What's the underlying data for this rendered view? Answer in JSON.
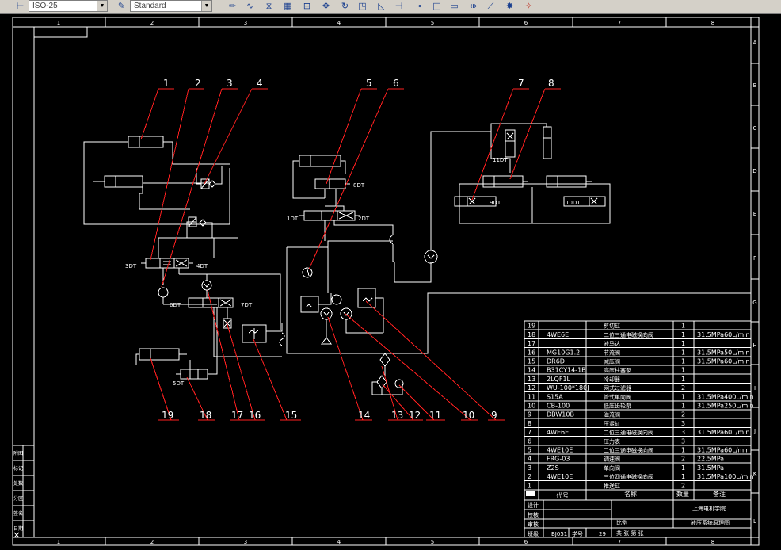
{
  "toolbar": {
    "dimstyle_value": "ISO-25",
    "textstyle_value": "Standard",
    "icons": [
      "dimstyle-icon",
      "textstyle-icon",
      "pencil-icon",
      "fillet-icon",
      "mirror-icon",
      "array-icon",
      "grid-icon",
      "move-icon",
      "rotate-icon",
      "scale-icon",
      "stretch-icon",
      "trim-icon",
      "extend-icon",
      "rectangle-icon",
      "break-icon",
      "chamfer-icon",
      "explode-icon"
    ]
  },
  "frame": {
    "col_numbers": [
      "1",
      "2",
      "3",
      "4",
      "5",
      "6",
      "7",
      "8"
    ],
    "row_letters": [
      "A",
      "B",
      "C",
      "D",
      "E",
      "F",
      "G",
      "H",
      "I",
      "J",
      "K",
      "L"
    ]
  },
  "callouts": {
    "top": [
      "1",
      "2",
      "3",
      "4",
      "5",
      "6",
      "7",
      "8"
    ],
    "bottom": [
      "19",
      "18",
      "17",
      "16",
      "15",
      "14",
      "13",
      "12",
      "11",
      "10",
      "9"
    ]
  },
  "solenoids": {
    "s1": "1DT",
    "s2": "2DT",
    "s3": "3DT",
    "s4": "4DT",
    "s5": "5DT",
    "s6": "6DT",
    "s7": "7DT",
    "s8": "8DT",
    "s9": "9DT",
    "s10": "10DT",
    "s11": "11DT"
  },
  "bom": {
    "rows": [
      {
        "no": "19",
        "code": "",
        "name": "剪切缸",
        "qty": "1",
        "note": ""
      },
      {
        "no": "18",
        "code": "4WE6E",
        "name": "二位三通电磁换向阀",
        "qty": "1",
        "note": "31.5MPa60L/min"
      },
      {
        "no": "17",
        "code": "",
        "name": "液马达",
        "qty": "1",
        "note": ""
      },
      {
        "no": "16",
        "code": "MG10G1.2",
        "name": "节流阀",
        "qty": "1",
        "note": "31.5MPa50L/min"
      },
      {
        "no": "15",
        "code": "DR6D",
        "name": "减压阀",
        "qty": "1",
        "note": "31.5MPa60L/min"
      },
      {
        "no": "14",
        "code": "B31CY14-1B",
        "name": "高压柱塞泵",
        "qty": "1",
        "note": ""
      },
      {
        "no": "13",
        "code": "2LQF1L",
        "name": "冷却器",
        "qty": "1",
        "note": ""
      },
      {
        "no": "12",
        "code": "WU-100*180J",
        "name": "网式过滤器",
        "qty": "2",
        "note": ""
      },
      {
        "no": "11",
        "code": "S15A",
        "name": "管式单向阀",
        "qty": "1",
        "note": "31.5MPa400L/min"
      },
      {
        "no": "10",
        "code": "CB-100",
        "name": "低压齿轮泵",
        "qty": "1",
        "note": "31.5MPa250L/min"
      },
      {
        "no": "9",
        "code": "DBW10B",
        "name": "溢流阀",
        "qty": "2",
        "note": ""
      },
      {
        "no": "8",
        "code": "",
        "name": "压紧缸",
        "qty": "3",
        "note": ""
      },
      {
        "no": "7",
        "code": "4WE6E",
        "name": "二位三通电磁换向阀",
        "qty": "3",
        "note": "31.5MPa60L/min"
      },
      {
        "no": "6",
        "code": "",
        "name": "压力表",
        "qty": "3",
        "note": ""
      },
      {
        "no": "5",
        "code": "4WE10E",
        "name": "二位三通电磁换向阀",
        "qty": "1",
        "note": "31.5MPa60L/min"
      },
      {
        "no": "4",
        "code": "FRG-03",
        "name": "调速阀",
        "qty": "2",
        "note": "22.5MPa"
      },
      {
        "no": "3",
        "code": "Z2S",
        "name": "单向阀",
        "qty": "1",
        "note": "31.5MPa"
      },
      {
        "no": "2",
        "code": "4WE10E",
        "name": "三位四通电磁换向阀",
        "qty": "1",
        "note": "31.5MPa100L/min"
      },
      {
        "no": "1",
        "code": "",
        "name": "推送缸",
        "qty": "2",
        "note": ""
      }
    ],
    "header": {
      "code": "代号",
      "name": "名称",
      "qty": "数量",
      "note": "备注"
    }
  },
  "titleblock": {
    "design": "设计",
    "check": "校核",
    "review": "审核",
    "class": "班级",
    "class_value": "BJ051",
    "student_no": "学号",
    "student_no_value": "29",
    "school": "上海电机学院",
    "scale": "比例",
    "drawing_title": "液压系统原理图",
    "sheet": "共  张  第  张"
  },
  "left_strip": {
    "cells": [
      "附图",
      "标记",
      "处数",
      "分区",
      "签名",
      "日期"
    ]
  },
  "colors": {
    "background": "#000000",
    "lines": "#ffffff",
    "leaders": "#ff0000",
    "toolbar": "#d4d0c8"
  }
}
